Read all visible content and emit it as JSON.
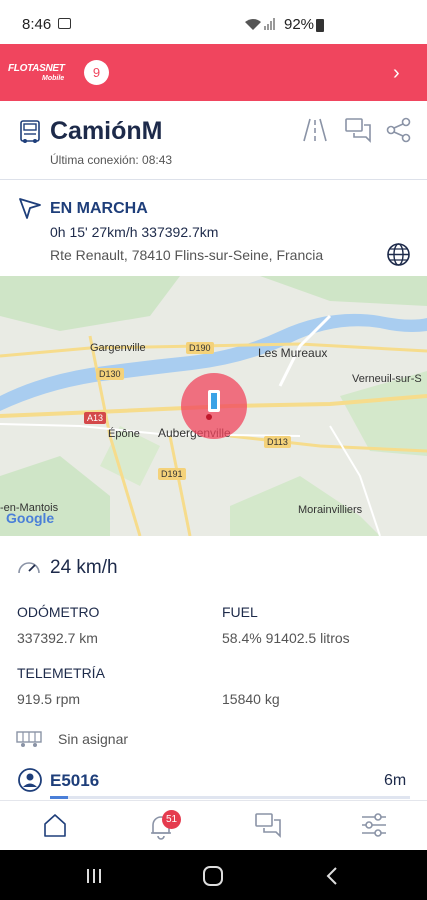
{
  "status_bar": {
    "time": "8:46",
    "battery": "92%"
  },
  "app": {
    "logo": "FLOTASNET",
    "logo_sub": "Mobile",
    "badge_count": "9"
  },
  "vehicle": {
    "name": "CamiónM",
    "last_connection": "Última conexión: 08:43",
    "status": "EN MARCHA",
    "stats": "0h 15'  27km/h  337392.7km",
    "address": "Rte Renault, 78410 Flins-sur-Seine, Francia"
  },
  "map": {
    "places": [
      "Gargenville",
      "Les Mureaux",
      "Verneuil-sur-S",
      "Épône",
      "Aubergenville",
      "Morainvilliers",
      "-en-Mantois"
    ],
    "roads": [
      "D190",
      "D130",
      "A13",
      "D113",
      "D191"
    ],
    "attribution": "Google"
  },
  "details": {
    "speed": "24 km/h",
    "odometer_label": "ODÓMETRO",
    "odometer_value": "337392.7 km",
    "fuel_label": "FUEL",
    "fuel_value": "58.4%  91402.5 litros",
    "telemetry_label": "TELEMETRÍA",
    "rpm_value": "919.5 rpm",
    "weight_value": "15840 kg",
    "trailer": "Sin asignar",
    "driver_code": "E5016",
    "driver_time": "6m"
  },
  "nav": {
    "notifications_count": "51"
  },
  "colors": {
    "brand": "#f0455e",
    "navy": "#1e3e7a"
  }
}
